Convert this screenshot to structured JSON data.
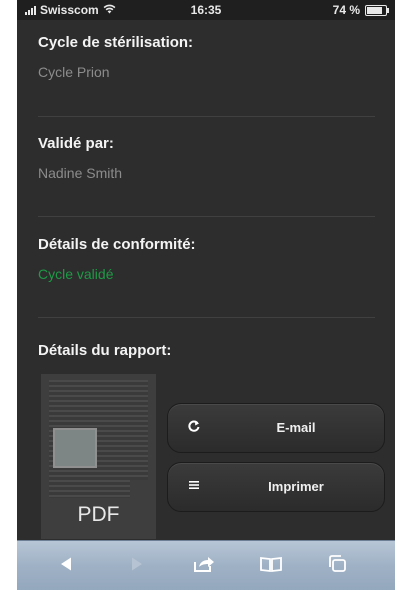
{
  "status_bar": {
    "carrier": "Swisscom",
    "time": "16:35",
    "battery": "74 %",
    "battery_level": 0.74
  },
  "sections": [
    {
      "label": "Cycle de stérilisation:",
      "value": "Cycle Prion"
    },
    {
      "label": "Validé par:",
      "value": "Nadine Smith"
    },
    {
      "label": "Détails de conformité:",
      "value": "Cycle validé"
    },
    {
      "label": "Détails du rapport:"
    }
  ],
  "report": {
    "thumbnail_label": "PDF",
    "buttons": [
      {
        "label": "E-mail",
        "icon": "refresh-arrow-icon"
      },
      {
        "label": "Imprimer",
        "icon": "list-icon"
      }
    ]
  },
  "toolbar": {
    "items": [
      "back-arrow-icon",
      "forward-arrow-icon",
      "share-icon",
      "bookmarks-icon",
      "tabs-icon"
    ]
  },
  "colors": {
    "background": "#2d2d2d",
    "label": "#f4f4f4",
    "value": "#8c8c8c",
    "success": "#1e9a46",
    "toolbar": "#9fb1c5"
  }
}
